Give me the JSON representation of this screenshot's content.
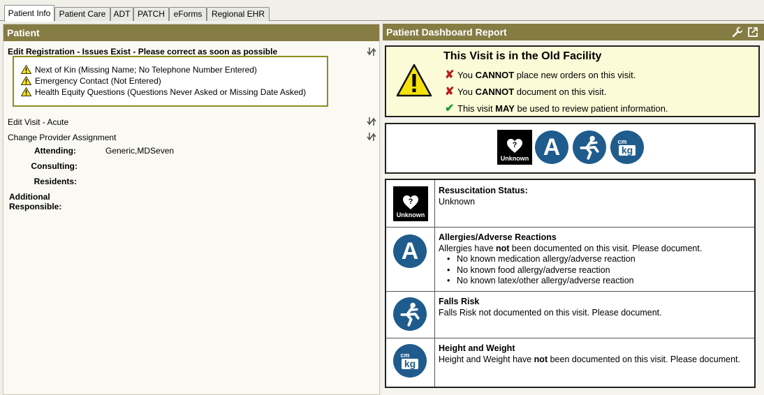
{
  "tabs": [
    "Patient Info",
    "Patient Care",
    "ADT",
    "PATCH",
    "eForms",
    "Regional EHR"
  ],
  "left": {
    "title": "Patient",
    "registration_header": "Edit Registration - Issues Exist - Please correct as soon as possible",
    "issues": [
      "Next of Kin (Missing Name; No Telephone Number Entered)",
      "Emergency Contact (Not Entered)",
      "Health Equity Questions (Questions Never Asked or Missing Date Asked)"
    ],
    "edit_visit": "Edit Visit - Acute",
    "change_provider": "Change Provider Assignment",
    "attending_label": "Attending:",
    "attending_value": "Generic,MDSeven",
    "consulting_label": "Consulting:",
    "residents_label": "Residents:",
    "additional_label": "Additional Responsible:"
  },
  "right": {
    "title": "Patient Dashboard Report",
    "old_facility": {
      "title": "This Visit is in the Old Facility",
      "line1_pre": "You ",
      "line1_bold": "CANNOT",
      "line1_post": " place new orders on this visit.",
      "line2_pre": "You ",
      "line2_bold": "CANNOT",
      "line2_post": " document on this visit.",
      "line3_pre": "This visit ",
      "line3_bold": "MAY",
      "line3_post": " be used to review patient information."
    },
    "icon_unknown_label": "Unknown",
    "icon_allergy_letter": "A",
    "icon_cm": "cm",
    "icon_kg": "kg",
    "resus": {
      "title": "Resuscitation Status:",
      "value": "Unknown"
    },
    "allergies": {
      "title": "Allergies/Adverse Reactions",
      "desc_pre": "Allergies have ",
      "desc_bold": "not",
      "desc_post": " been documented on this visit. Please document.",
      "items": [
        "No known medication allergy/adverse reaction",
        "No known food allergy/adverse reaction",
        "No known latex/other allergy/adverse reaction"
      ]
    },
    "falls": {
      "title": "Falls Risk",
      "desc": "Falls Risk not documented on this visit. Please document."
    },
    "height_weight": {
      "title": "Height and Weight",
      "desc_pre": "Height and Weight have ",
      "desc_bold": "not",
      "desc_post": " been documented on this visit. Please document."
    }
  },
  "colors": {
    "header": "#857c43",
    "icon_blue": "#1f5c8d",
    "alert_bg": "#fbfbd8"
  }
}
